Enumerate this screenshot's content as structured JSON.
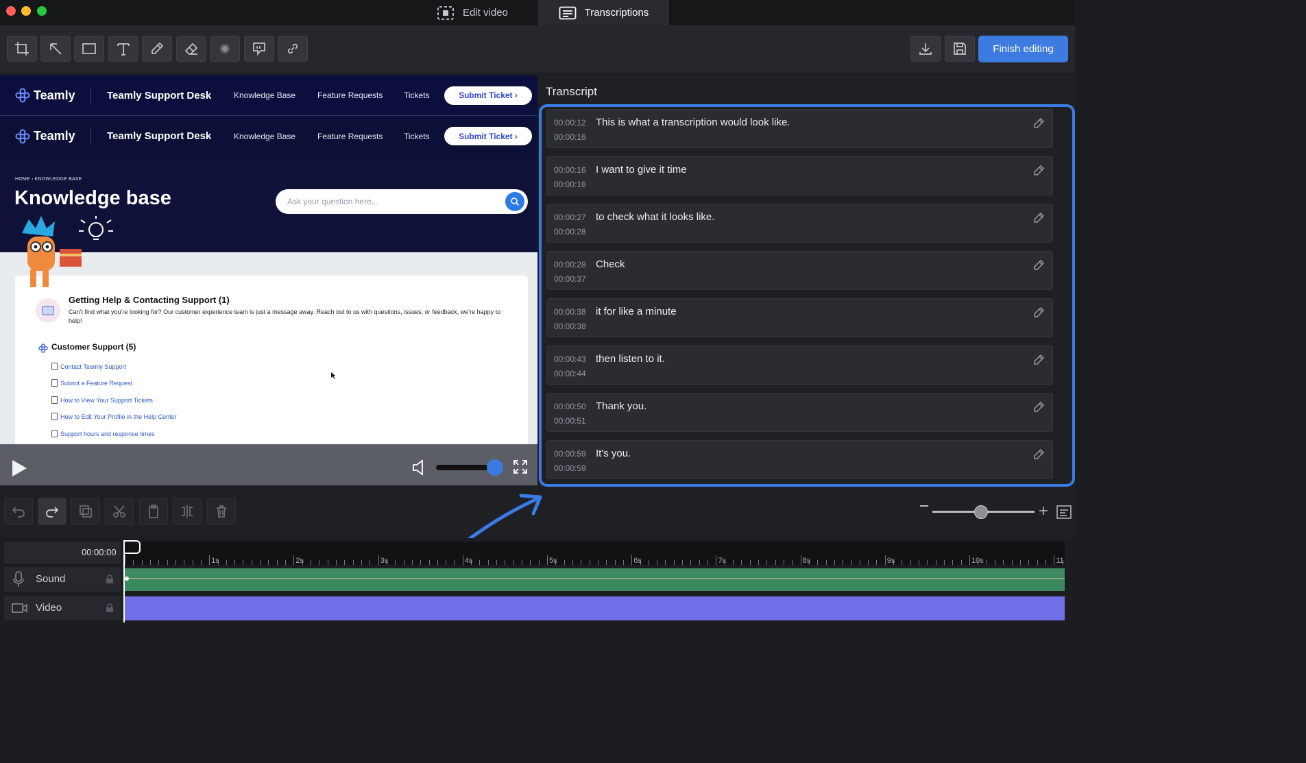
{
  "window": {
    "tabs": [
      {
        "label": "Edit video",
        "icon": "select-frame-icon",
        "active": false
      },
      {
        "label": "Transcriptions",
        "icon": "transcript-icon",
        "active": true
      }
    ]
  },
  "toolbar": {
    "tools": [
      "crop-icon",
      "arrow-icon",
      "rectangle-icon",
      "text-icon",
      "pencil-icon",
      "eraser-icon",
      "blur-icon",
      "callout-icon",
      "link-icon"
    ],
    "finish_label": "Finish editing",
    "accent": "#3d7be0"
  },
  "video": {
    "site": {
      "brand": "Teamly",
      "desk_title": "Teamly Support Desk",
      "nav": [
        "Knowledge Base",
        "Feature Requests",
        "Tickets"
      ],
      "submit_label": "Submit Ticket ›"
    },
    "breadcrumb": "HOME  ›  KNOWLEDGE BASE",
    "kb_title": "Knowledge base",
    "search_placeholder": "Ask your question here...",
    "help_title": "Getting Help & Contacting Support (1)",
    "help_desc": "Can’t find what you’re looking for? Our customer experience team is just a message away. Reach out to us with questions, issues, or feedback, we’re happy to help!",
    "cs_title": "Customer Support (5)",
    "articles": [
      "Contact Teamly Support",
      "Submit a Feature Request",
      "How to View Your Support Tickets",
      "How to Edit Your Profile in the Help Center",
      "Support hours and response times"
    ],
    "volume": 0.85
  },
  "transcript": {
    "label": "Transcript",
    "rows": [
      {
        "start": "00:00:12",
        "end": "00:00:16",
        "text": "This is what a transcription would look like."
      },
      {
        "start": "00:00:16",
        "end": "00:00:16",
        "text": "I want to give it time"
      },
      {
        "start": "00:00:27",
        "end": "00:00:28",
        "text": "to check what it looks like."
      },
      {
        "start": "00:00:28",
        "end": "00:00:37",
        "text": "Check"
      },
      {
        "start": "00:00:38",
        "end": "00:00:38",
        "text": "it for like a minute"
      },
      {
        "start": "00:00:43",
        "end": "00:00:44",
        "text": "then listen to it."
      },
      {
        "start": "00:00:50",
        "end": "00:00:51",
        "text": "Thank you."
      },
      {
        "start": "00:00:59",
        "end": "00:00:59",
        "text": "It's you."
      }
    ]
  },
  "edit_tools": [
    "undo-icon",
    "redo-icon",
    "duplicate-icon",
    "cut-icon",
    "paste-icon",
    "split-icon",
    "delete-icon"
  ],
  "timeline": {
    "current_time": "00:00:00",
    "ruler_labels": [
      "1s",
      "2s",
      "3s",
      "4s",
      "5s",
      "6s",
      "7s",
      "8s",
      "9s",
      "10s",
      "11"
    ],
    "tracks": [
      {
        "label": "Sound",
        "icon": "microphone-icon",
        "color": "#3d8a60"
      },
      {
        "label": "Video",
        "icon": "camera-icon",
        "color": "#7170e9"
      }
    ],
    "zoom_level": 0.45
  }
}
